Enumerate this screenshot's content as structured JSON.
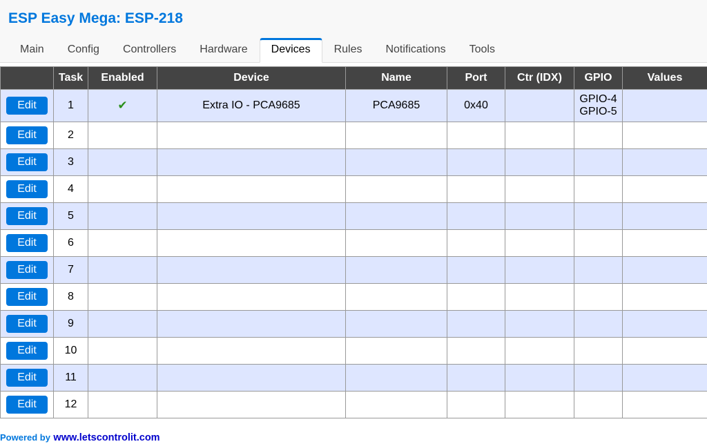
{
  "header": {
    "title": "ESP Easy Mega: ESP-218"
  },
  "tabs": [
    {
      "label": "Main"
    },
    {
      "label": "Config"
    },
    {
      "label": "Controllers"
    },
    {
      "label": "Hardware"
    },
    {
      "label": "Devices",
      "active": true
    },
    {
      "label": "Rules"
    },
    {
      "label": "Notifications"
    },
    {
      "label": "Tools"
    }
  ],
  "table": {
    "columns": [
      "Task",
      "Enabled",
      "Device",
      "Name",
      "Port",
      "Ctr (IDX)",
      "GPIO",
      "Values"
    ],
    "edit_label": "Edit",
    "rows": [
      {
        "task": "1",
        "enabled": true,
        "enabled_icon": "check-icon",
        "device": "Extra IO - PCA9685",
        "name": "PCA9685",
        "port": "0x40",
        "gpio": [
          "GPIO-4",
          "GPIO-5"
        ]
      },
      {
        "task": "2"
      },
      {
        "task": "3"
      },
      {
        "task": "4"
      },
      {
        "task": "5"
      },
      {
        "task": "6"
      },
      {
        "task": "7"
      },
      {
        "task": "8"
      },
      {
        "task": "9"
      },
      {
        "task": "10"
      },
      {
        "task": "11"
      },
      {
        "task": "12"
      }
    ]
  },
  "footer": {
    "prefix": "Powered by",
    "link": "www.letscontrolit.com"
  },
  "colors": {
    "accent": "#0077DD",
    "header_background": "#F8F8F8",
    "table_header": "#444444",
    "alternate_row": "#DEE6FF",
    "enabled": "#2A8F1A",
    "link": "#0000CC"
  }
}
